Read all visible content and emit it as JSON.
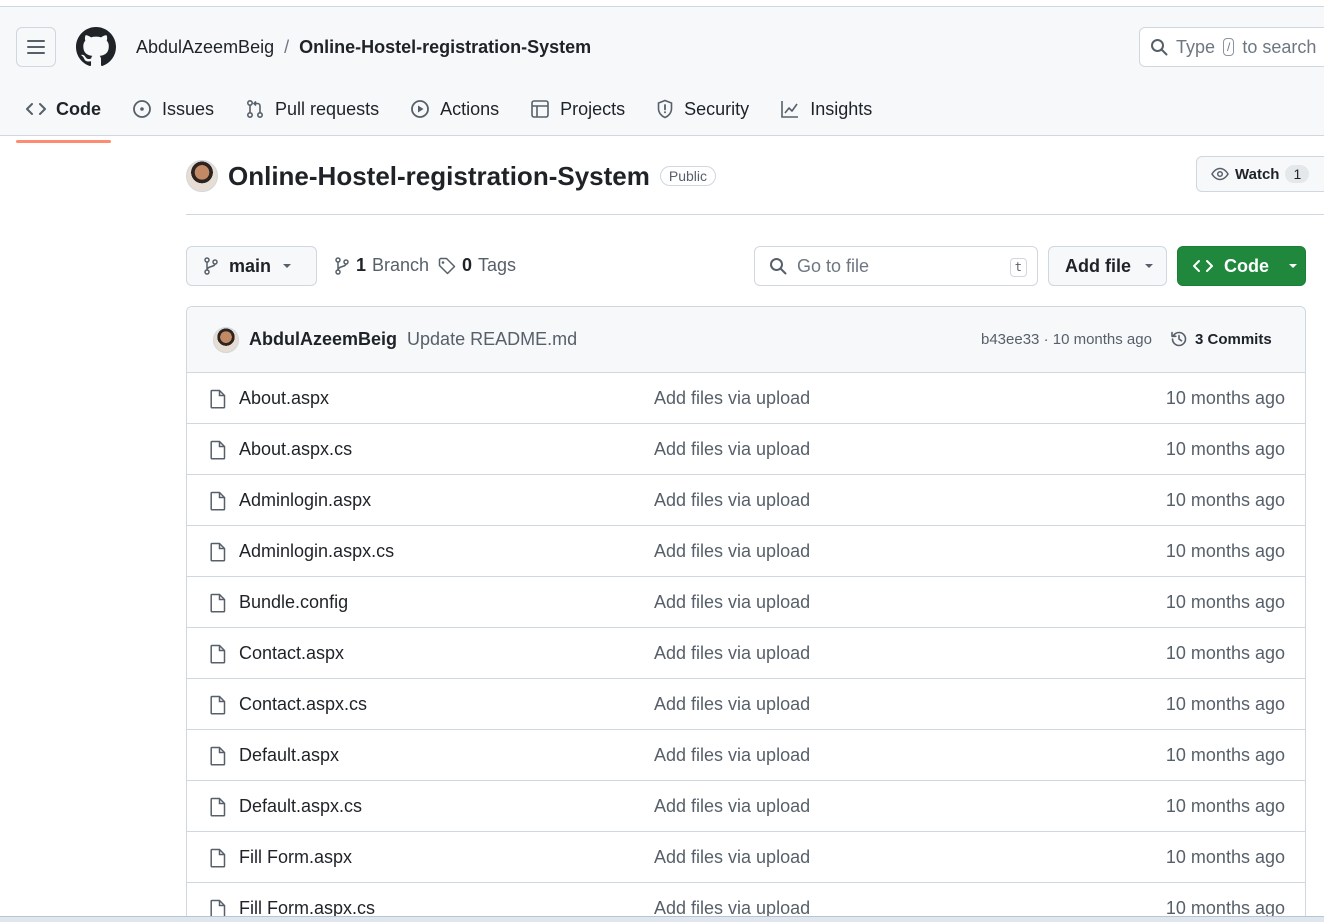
{
  "header": {
    "owner": "AbdulAzeemBeig",
    "separator": "/",
    "repo": "Online-Hostel-registration-System",
    "search_prefix": "Type",
    "search_key": "/",
    "search_suffix": "to search"
  },
  "nav": {
    "tabs": [
      {
        "label": "Code",
        "icon": "code-icon",
        "active": true
      },
      {
        "label": "Issues",
        "icon": "issue-icon"
      },
      {
        "label": "Pull requests",
        "icon": "pull-request-icon"
      },
      {
        "label": "Actions",
        "icon": "play-icon"
      },
      {
        "label": "Projects",
        "icon": "table-icon"
      },
      {
        "label": "Security",
        "icon": "shield-icon"
      },
      {
        "label": "Insights",
        "icon": "graph-icon"
      }
    ]
  },
  "repo": {
    "title": "Online-Hostel-registration-System",
    "visibility": "Public",
    "watch_label": "Watch",
    "watch_count": "1"
  },
  "toolbar": {
    "branch": "main",
    "branch_count": "1",
    "branch_label": "Branch",
    "tag_count": "0",
    "tag_label": "Tags",
    "goto_placeholder": "Go to file",
    "goto_key": "t",
    "add_file": "Add file",
    "code": "Code"
  },
  "commit": {
    "author": "AbdulAzeemBeig",
    "message": "Update README.md",
    "meta": "b43ee33 · 10 months ago",
    "commits": "3 Commits"
  },
  "files": [
    {
      "name": "About.aspx",
      "message": "Add files via upload",
      "date": "10 months ago"
    },
    {
      "name": "About.aspx.cs",
      "message": "Add files via upload",
      "date": "10 months ago"
    },
    {
      "name": "Adminlogin.aspx",
      "message": "Add files via upload",
      "date": "10 months ago"
    },
    {
      "name": "Adminlogin.aspx.cs",
      "message": "Add files via upload",
      "date": "10 months ago"
    },
    {
      "name": "Bundle.config",
      "message": "Add files via upload",
      "date": "10 months ago"
    },
    {
      "name": "Contact.aspx",
      "message": "Add files via upload",
      "date": "10 months ago"
    },
    {
      "name": "Contact.aspx.cs",
      "message": "Add files via upload",
      "date": "10 months ago"
    },
    {
      "name": "Default.aspx",
      "message": "Add files via upload",
      "date": "10 months ago"
    },
    {
      "name": "Default.aspx.cs",
      "message": "Add files via upload",
      "date": "10 months ago"
    },
    {
      "name": "Fill Form.aspx",
      "message": "Add files via upload",
      "date": "10 months ago"
    },
    {
      "name": "Fill Form.aspx.cs",
      "message": "Add files via upload",
      "date": "10 months ago"
    }
  ]
}
